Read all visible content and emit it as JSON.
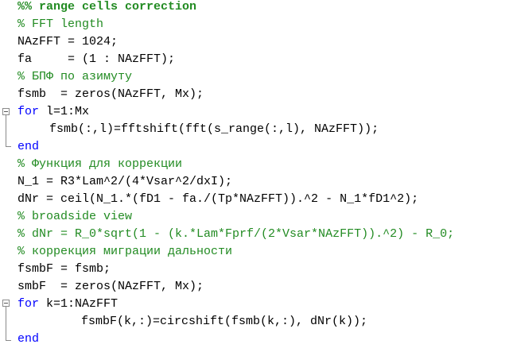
{
  "colors": {
    "comment": "#228b22",
    "keyword": "#0000ff",
    "text": "#000000",
    "background": "#ffffff"
  },
  "code": {
    "lines": [
      "%% range cells correction",
      "% FFT length",
      "NAzFFT = 1024;",
      "fa     = (1 : NAzFFT);",
      "% БПФ по азимуту",
      "fsmb  = zeros(NAzFFT, Mx);",
      "for",
      " l=1:Mx",
      "fsmb(:,l)=fftshift(fft(s_range(:,l), NAzFFT));",
      "end",
      "% Функция для коррекции",
      "N_1 = R3*Lam^2/(4*Vsar^2/dxI);",
      "dNr = ceil(N_1.*(fD1 - fa./(Tp*NAzFFT)).^2 - N_1*fD1^2);",
      "% broadside view",
      "% dNr = R_0*sqrt(1 - (k.*Lam*Fprf/(2*Vsar*NAzFFT)).^2) - R_0;",
      "% коррекция миграции дальности",
      "fsmbF = fsmb;",
      "smbF  = zeros(NAzFFT, Mx);",
      "for",
      " k=1:NAzFFT",
      "fsmbF(k,:)=circshift(fsmb(k,:), dNr(k));",
      "end"
    ]
  }
}
